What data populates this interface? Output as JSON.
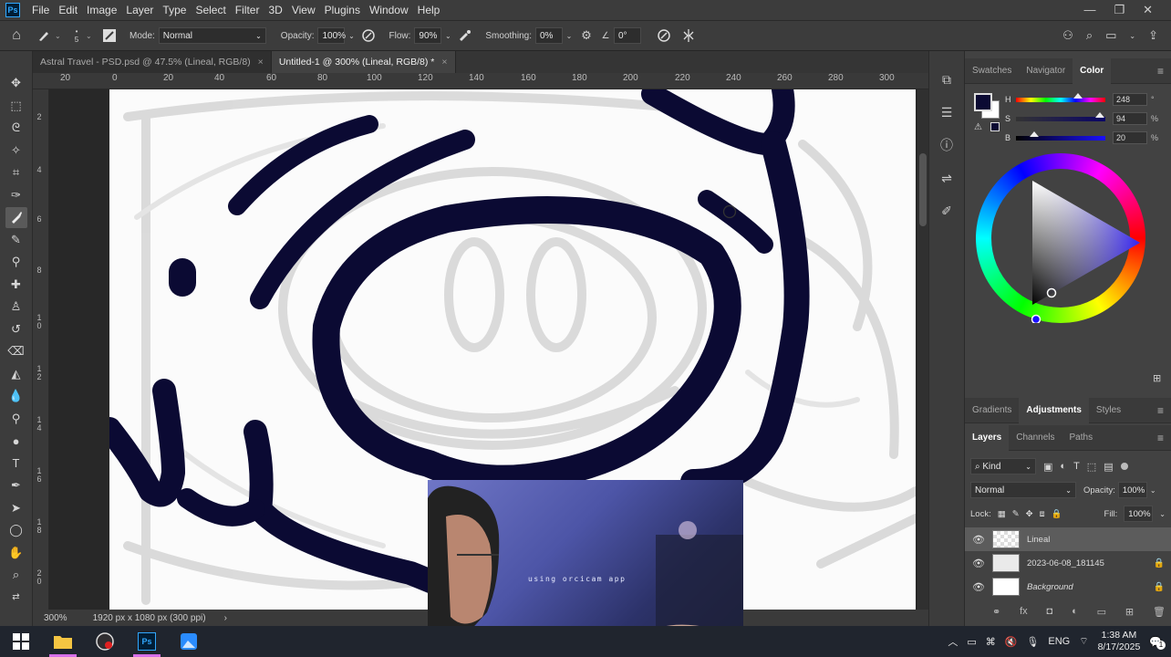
{
  "app": {
    "logo_text": "Ps",
    "menu": [
      "File",
      "Edit",
      "Image",
      "Layer",
      "Type",
      "Select",
      "Filter",
      "3D",
      "View",
      "Plugins",
      "Window",
      "Help"
    ],
    "window_controls": [
      "—",
      "❐",
      "✕"
    ]
  },
  "options_bar": {
    "brush_size": "5",
    "mode_label": "Mode:",
    "mode_value": "Normal",
    "opacity_label": "Opacity:",
    "opacity_value": "100%",
    "flow_label": "Flow:",
    "flow_value": "90%",
    "smoothing_label": "Smoothing:",
    "smoothing_value": "0%",
    "angle_value": "0°"
  },
  "tabs": [
    {
      "label": "Astral Travel - PSD.psd @ 47.5% (Lineal, RGB/8)",
      "active": false
    },
    {
      "label": "Untitled-1 @ 300% (Lineal, RGB/8) *",
      "active": true
    }
  ],
  "ruler": {
    "h_ticks": [
      "20",
      "0",
      "20",
      "40",
      "60",
      "80",
      "100",
      "120",
      "140",
      "160",
      "180",
      "200",
      "220",
      "240",
      "260",
      "280",
      "300"
    ],
    "v_ticks": [
      "2",
      "4",
      "6",
      "8",
      "1 0",
      "1 2",
      "1 4",
      "1 6",
      "1 8",
      "2 0"
    ]
  },
  "status": {
    "zoom": "300%",
    "doc_size": "1920 px x 1080 px (300 ppi)"
  },
  "color_panel": {
    "tabs": [
      "Swatches",
      "Navigator",
      "Color"
    ],
    "active_tab": "Color",
    "h_label": "H",
    "s_label": "S",
    "b_label": "B",
    "h_value": "248",
    "s_value": "94",
    "b_value": "20",
    "h_unit": "°",
    "s_unit": "%",
    "b_unit": "%",
    "h_fraction": 0.69,
    "s_fraction": 0.94,
    "b_fraction": 0.2,
    "foreground_color": "#0b0a33",
    "background_color": "#ffffff"
  },
  "adjustments_panel": {
    "tabs": [
      "Gradients",
      "Adjustments",
      "Styles"
    ],
    "active_tab": "Adjustments"
  },
  "layers_panel": {
    "tabs": [
      "Layers",
      "Channels",
      "Paths"
    ],
    "active_tab": "Layers",
    "filter_label": "Kind",
    "blend_mode": "Normal",
    "opacity_label": "Opacity:",
    "opacity_value": "100%",
    "lock_label": "Lock:",
    "fill_label": "Fill:",
    "fill_value": "100%",
    "layers": [
      {
        "name": "Lineal",
        "locked": false,
        "selected": true
      },
      {
        "name": "2023-06-08_181145",
        "locked": true,
        "selected": false
      },
      {
        "name": "Background",
        "locked": true,
        "selected": false
      }
    ]
  },
  "webcam": {
    "caption": "using orcicam app"
  },
  "taskbar": {
    "language": "ENG",
    "time": "1:38 AM",
    "date": "8/17/2025",
    "notification_count": "1"
  },
  "colors": {
    "ink": "#0b0a33",
    "accent": "#31a8ff",
    "taskbar_underline": "#d76fe8"
  }
}
